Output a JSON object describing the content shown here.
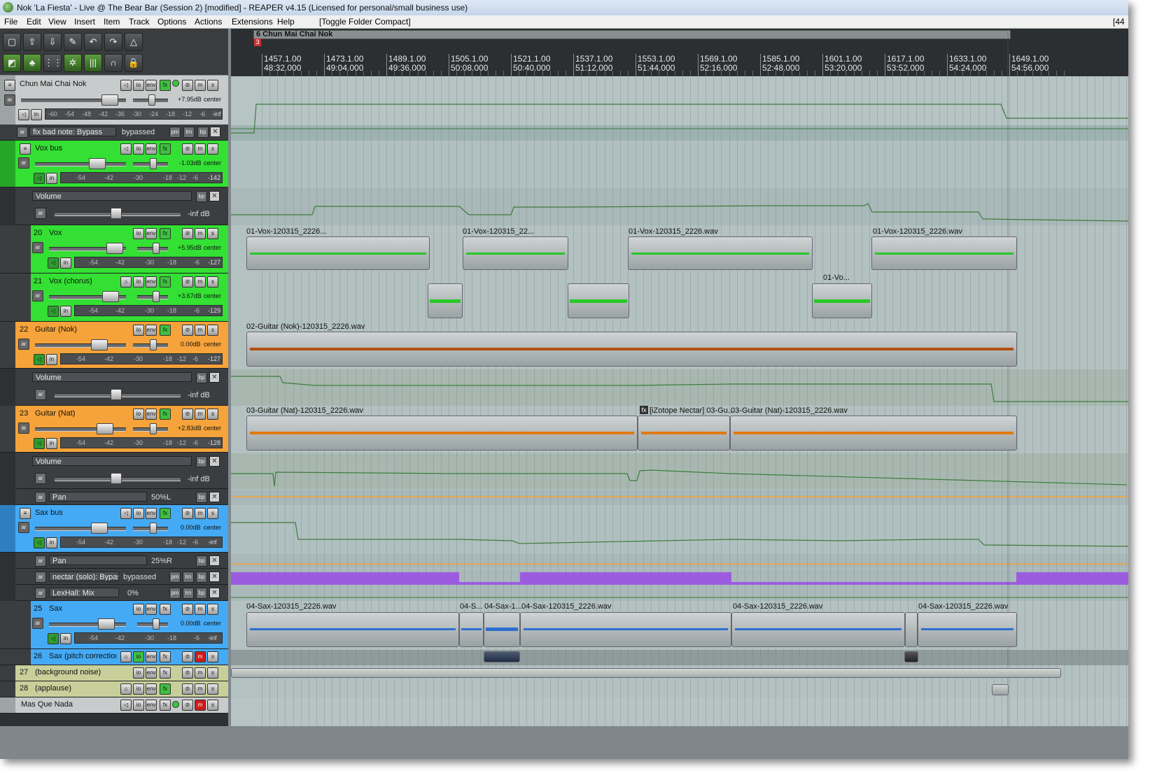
{
  "window": {
    "title": "Nok 'La Fiesta' - Live @ The Bear Bar (Session 2) [modified] - REAPER v4.15 (Licensed for personal/small business use)"
  },
  "menu": {
    "items": [
      "File",
      "Edit",
      "View",
      "Insert",
      "Item",
      "Track",
      "Options",
      "Actions",
      "Extensions",
      "Help"
    ],
    "toggle_label": "[Toggle Folder Compact]",
    "right_indicator": "[44"
  },
  "toolbar": {
    "row1_icons": [
      "new-project-icon",
      "open-project-icon",
      "save-project-icon",
      "project-settings-icon",
      "undo-icon",
      "redo-icon",
      "metronome-icon"
    ],
    "row2_icons": [
      "snap-icon",
      "ripple-edit-icon",
      "grid-icon",
      "auto-crossfade-icon",
      "mixer-icon",
      "loop-icon",
      "lock-icon"
    ]
  },
  "region": {
    "label": "6 Chun Mai Chai Nok",
    "marker": "3"
  },
  "ruler": {
    "bars": [
      "1457.1.00",
      "1473.1.00",
      "1489.1.00",
      "1505.1.00",
      "1521.1.00",
      "1537.1.00",
      "1553.1.00",
      "1569.1.00",
      "1585.1.00",
      "1601.1.00",
      "1617.1.00",
      "1633.1.00",
      "1649.1.00"
    ],
    "times": [
      "48:32.000",
      "49:04.000",
      "49:36.000",
      "50:08.000",
      "50:40.000",
      "51:12.000",
      "51:44.000",
      "52:16.000",
      "52:48.000",
      "53:20.000",
      "53:52.000",
      "54:24.000",
      "54:56.000"
    ]
  },
  "tracks": {
    "chun": {
      "name": "Chun Mai Chai Nok",
      "vol": "+7.95dB",
      "pan": "center",
      "meter_end": "-inf",
      "meter_labels": [
        "-60",
        "-54",
        "-48",
        "-42",
        "-36",
        "-30",
        "-24",
        "-18",
        "-12",
        "-6"
      ],
      "volume": 0.85
    },
    "fx_env": {
      "name": "fix bad note: Bypass",
      "value": "bypassed"
    },
    "vox_bus": {
      "name": "Vox bus",
      "vol": "-1.03dB",
      "pan": "center",
      "meter_end": "-142",
      "meter_labels": [
        "-54",
        "-42",
        "-30",
        "-18",
        "-12",
        "-6"
      ],
      "volume": 0.62
    },
    "vox_bus_env": {
      "name": "Volume",
      "value": "-inf dB"
    },
    "vox": {
      "num": "20",
      "name": "Vox",
      "vol": "+5.95dB",
      "pan": "center",
      "meter_end": "-127",
      "meter_labels": [
        "-54",
        "-42",
        "-30",
        "-18",
        "-6"
      ],
      "volume": 0.8
    },
    "vox_chorus": {
      "num": "21",
      "name": "Vox (chorus)",
      "vol": "+3.67dB",
      "pan": "center",
      "meter_end": "-129",
      "meter_labels": [
        "-54",
        "-42",
        "-30",
        "-18",
        "-6"
      ],
      "volume": 0.75
    },
    "guitar_nok": {
      "num": "22",
      "name": "Guitar (Nok)",
      "vol": "0.00dB",
      "pan": "center",
      "meter_end": "-127",
      "meter_labels": [
        "-54",
        "-42",
        "-30",
        "-18",
        "-12",
        "-6"
      ],
      "volume": 0.68
    },
    "guitar_nok_env": {
      "name": "Volume",
      "value": "-inf dB"
    },
    "guitar_nat": {
      "num": "23",
      "name": "Guitar (Nat)",
      "vol": "+2.83dB",
      "pan": "center",
      "meter_end": "-128",
      "meter_labels": [
        "-54",
        "-42",
        "-30",
        "-18",
        "-12",
        "-6"
      ],
      "volume": 0.72
    },
    "guitar_nat_vol_env": {
      "name": "Volume",
      "value": "-inf dB"
    },
    "guitar_nat_pan_env": {
      "name": "Pan",
      "value": "50%L"
    },
    "sax_bus": {
      "name": "Sax bus",
      "vol": "0.00dB",
      "pan": "center",
      "meter_end": "-inf",
      "meter_labels": [
        "-54",
        "-42",
        "-30",
        "-18",
        "-12",
        "-6"
      ],
      "volume": 0.68
    },
    "sax_bus_pan_env": {
      "name": "Pan",
      "value": "25%R"
    },
    "sax_bus_fx_env": {
      "name": "nectar (solo): Bypass",
      "value": "bypassed"
    },
    "sax_bus_mix_env": {
      "name": "LexHall: Mix",
      "value": "0%"
    },
    "sax": {
      "num": "25",
      "name": "Sax",
      "vol": "0.00dB",
      "pan": "center",
      "meter_end": "-inf",
      "meter_labels": [
        "-54",
        "-42",
        "-30",
        "-18",
        "-6"
      ],
      "volume": 0.7
    },
    "sax_pitch": {
      "num": "26",
      "name": "Sax (pitch correction"
    },
    "bg_noise": {
      "num": "27",
      "name": "(background noise)"
    },
    "applause": {
      "num": "28",
      "name": "(applause)"
    },
    "mas_que": {
      "name": "Mas Que Nada"
    }
  },
  "buttons": {
    "io": "io",
    "env": "env",
    "fx": "fx",
    "mute": "m",
    "solo": "s",
    "arm": "ar",
    "bp": "bp",
    "pm": "pm",
    "lrn": "lrn",
    "x": "✕"
  },
  "items": {
    "vox_a": "01-Vox-120315_2226...",
    "vox_b": "01-Vox-120315_22...",
    "vox_c": "01-Vox-120315_2226.wav",
    "vox_d": "01-Vox-120315_2226.wav",
    "vox_short": "01-Vo...",
    "guitar_nok": "02-Guitar (Nok)-120315_2226.wav",
    "guitar_nat_a": "03-Guitar (Nat)-120315_2226.wav",
    "guitar_nat_fx": "[iZotope Nectar] 03-Gu...",
    "guitar_nat_b": "03-Guitar (Nat)-120315_2226.wav",
    "fx_badge": "fx",
    "sax_a": "04-Sax-120315_2226.wav",
    "sax_b": "04-S...",
    "sax_c": "04-Sax-1...",
    "sax_d": "04-Sax-120315_2226.wav",
    "sax_e": "04-Sax-120315_2226.wav",
    "sax_f": "04-Sax-120315_2226.wav"
  },
  "colors": {
    "green": "#33e033",
    "orange": "#f5a33a",
    "blue": "#44aaf5",
    "olive": "#c9cf9a",
    "grey": "#c8cbcc",
    "arrange_bg": "#b4c1c1",
    "envelope": "#3d7b3d",
    "pan_env": "#f5a33a",
    "bypass_env": "#9a4be6"
  }
}
